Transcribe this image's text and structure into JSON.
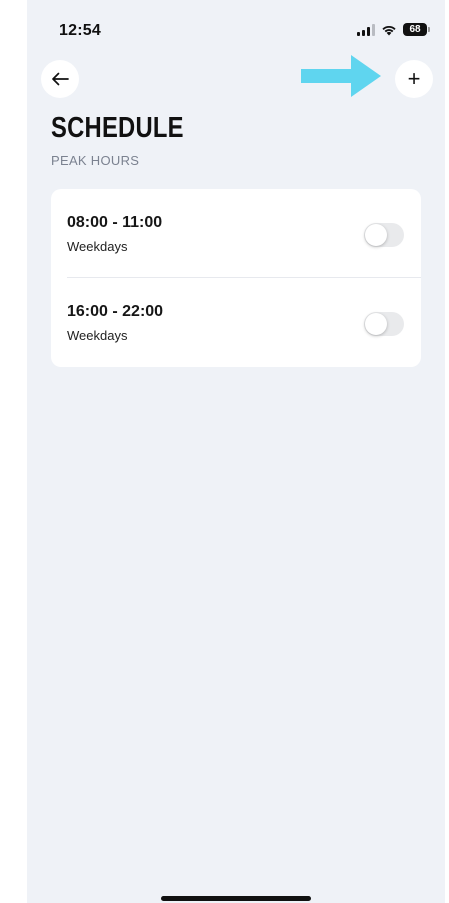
{
  "status_bar": {
    "time": "12:54",
    "battery": "68",
    "icons": [
      "signal-icon",
      "wifi-icon",
      "battery-icon"
    ]
  },
  "header": {
    "back_icon": "arrow-left-icon",
    "add_icon": "plus-icon",
    "add_label": "+",
    "annotation_icon": "arrow-right-annotation-icon",
    "annotation_color": "#5fd5ef"
  },
  "page": {
    "title": "SCHEDULE",
    "subtitle": "PEAK HOURS"
  },
  "schedules": [
    {
      "time_range": "08:00 - 11:00",
      "days": "Weekdays",
      "enabled": false
    },
    {
      "time_range": "16:00 - 22:00",
      "days": "Weekdays",
      "enabled": false
    }
  ],
  "colors": {
    "background": "#eff2f7",
    "card": "#ffffff",
    "toggle_off": "#e9eaec",
    "subtitle": "#7b8290"
  }
}
